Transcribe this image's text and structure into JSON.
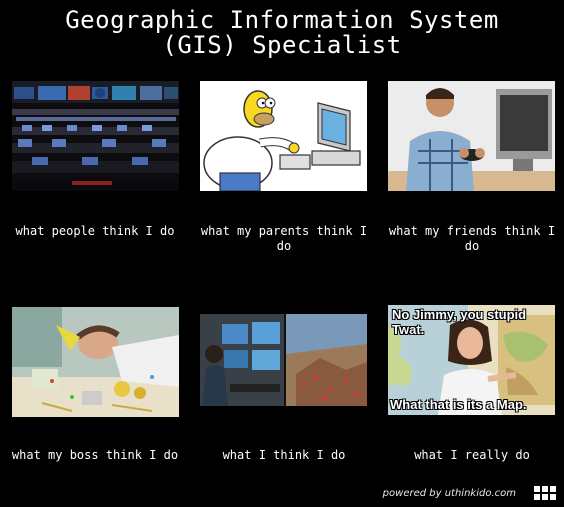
{
  "title": {
    "line1": "Geographic Information System",
    "line2": "(GIS) Specialist"
  },
  "panels": [
    {
      "caption": "what people think I do",
      "image": "control-room-photo"
    },
    {
      "caption": "what my parents think I do",
      "image": "homer-computer-cartoon"
    },
    {
      "caption": "what my friends think I do",
      "image": "gamer-at-computer-photo"
    },
    {
      "caption": "what my boss think I do",
      "image": "sleeping-at-desk-photo"
    },
    {
      "caption": "what I think I do",
      "image": "gis-workstation-and-3d-map-photo"
    },
    {
      "caption": "what I really do",
      "image": "teacher-with-map-meme",
      "overlay_top": "No Jimmy, you stupid Twat.",
      "overlay_bottom": "What that is its a Map."
    }
  ],
  "footer": {
    "powered_by": "powered by uthinkido.com"
  }
}
